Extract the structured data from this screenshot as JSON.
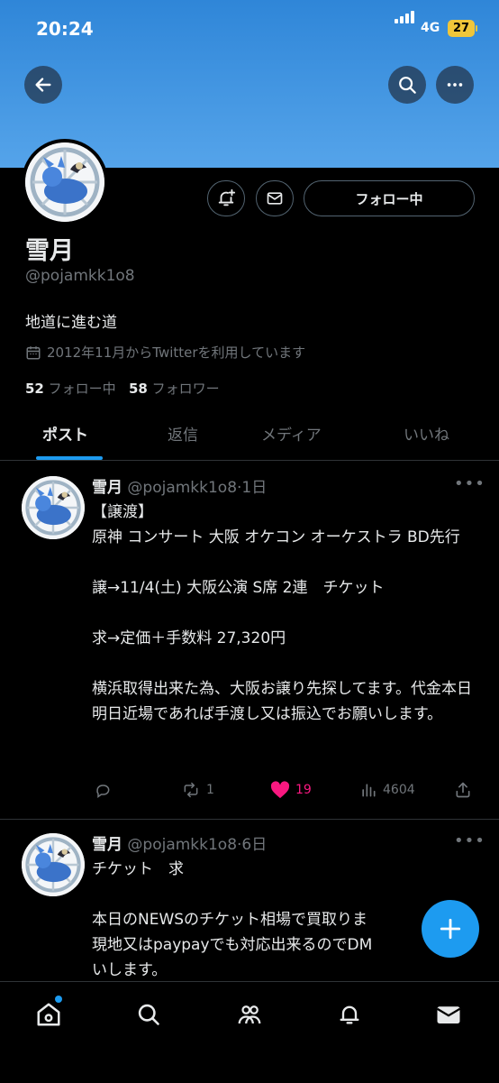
{
  "status_bar": {
    "time": "20:24",
    "network": "4G",
    "battery": "27"
  },
  "profile": {
    "name": "雪月",
    "handle": "@pojamkk1o8",
    "bio": "地道に進む道",
    "joined": "2012年11月からTwitterを利用しています",
    "following_count": "52",
    "following_label": "フォロー中",
    "followers_count": "58",
    "followers_label": "フォロワー",
    "follow_button": "フォロー中"
  },
  "tabs": [
    "ポスト",
    "返信",
    "メディア",
    "いいね"
  ],
  "posts": [
    {
      "name": "雪月",
      "handle": "@pojamkk1o8",
      "time": "·1日",
      "text": "【譲渡】\n原神 コンサート 大阪 オケコン オーケストラ BD先行\n\n譲→11/4(土) 大阪公演 S席 2連　チケット\n\n求→定価＋手数料 27,320円\n\n横浜取得出来た為、大阪お譲り先探してます。代金本日明日近場であれば手渡し又は振込でお願いします。",
      "replies": "",
      "reposts": "1",
      "likes": "19",
      "views": "4604"
    },
    {
      "name": "雪月",
      "handle": "@pojamkk1o8",
      "time": "·6日",
      "text": "チケット　求\n\n本日のNEWSのチケット相場で買取りま\n現地又はpaypayでも対応出来るのでDM\nいします。"
    }
  ],
  "colors": {
    "accent": "#1d9bf0",
    "like": "#f91880",
    "banner": "#3a8fdc"
  },
  "icons": [
    "back-arrow-icon",
    "search-icon",
    "more-icon",
    "bell-plus-icon",
    "mail-icon",
    "calendar-icon",
    "reply-icon",
    "repost-icon",
    "heart-icon",
    "views-icon",
    "share-icon",
    "plus-icon",
    "home-icon",
    "explore-icon",
    "communities-icon",
    "notifications-icon",
    "messages-icon"
  ]
}
